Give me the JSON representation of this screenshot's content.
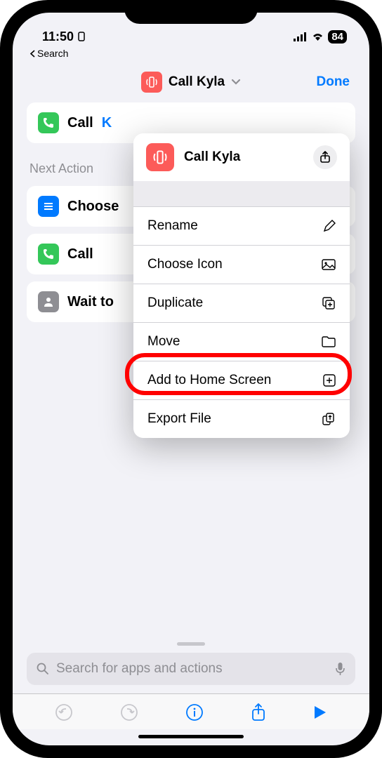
{
  "status": {
    "time": "11:50",
    "battery": "84"
  },
  "back": {
    "label": "Search"
  },
  "header": {
    "title": "Call Kyla",
    "done": "Done"
  },
  "mainAction": {
    "verb": "Call",
    "param": "K"
  },
  "section": {
    "label": "Next Action"
  },
  "suggestions": [
    {
      "label": "Choose"
    },
    {
      "label": "Call"
    },
    {
      "label": "Wait to"
    }
  ],
  "popover": {
    "title": "Call Kyla",
    "items": [
      {
        "label": "Rename"
      },
      {
        "label": "Choose Icon"
      },
      {
        "label": "Duplicate"
      },
      {
        "label": "Move"
      },
      {
        "label": "Add to Home Screen"
      },
      {
        "label": "Export File"
      }
    ]
  },
  "search": {
    "placeholder": "Search for apps and actions"
  }
}
